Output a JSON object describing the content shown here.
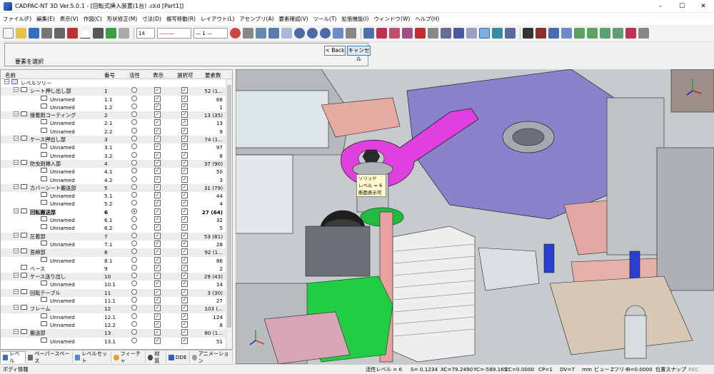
{
  "title": "CADPAC-NT 3D Ver.5.0.1 - [回転式挿入装置(1台) .ckd [Part1]]",
  "window_controls": {
    "minimize": "–",
    "maximize": "☐",
    "close": "✕"
  },
  "menu": [
    "ファイル(F)",
    "編集(E)",
    "表示(V)",
    "作図(C)",
    "形状修正(M)",
    "寸法(D)",
    "複写移動(R)",
    "レイアウト(L)",
    "アセンブリ(A)",
    "要素確認(V)",
    "ツール(T)",
    "拡張機能(I)",
    "ウィンドウ(W)",
    "ヘルプ(H)"
  ],
  "toolbar": {
    "line_width": "14",
    "line_style": "———",
    "line_type": "— 1 —"
  },
  "command_panel": {
    "prompt": "要素を選択",
    "back_label": "< Back",
    "cancel_label": "キャンセル"
  },
  "tree": {
    "headers": {
      "name": "名前",
      "number": "番号",
      "active": "活性",
      "display": "表示",
      "selectable": "選択可",
      "elements": "要素数"
    },
    "root_label": "レベルツリー",
    "rows": [
      {
        "kind": "group",
        "name": "シート押し出し部",
        "number": "1",
        "elements": "52 (1..."
      },
      {
        "kind": "item",
        "name": "Unnamed",
        "number": "1.1",
        "elements": "68"
      },
      {
        "kind": "item",
        "name": "Unnamed",
        "number": "1.2",
        "elements": "1"
      },
      {
        "kind": "group",
        "name": "接着剤コーティング",
        "number": "2",
        "elements": "13 (35)"
      },
      {
        "kind": "item",
        "name": "Unnamed",
        "number": "2.1",
        "elements": "13"
      },
      {
        "kind": "item",
        "name": "Unnamed",
        "number": "2.2",
        "elements": "9"
      },
      {
        "kind": "group",
        "name": "ケース押出し部",
        "number": "3",
        "elements": "74 (1..."
      },
      {
        "kind": "item",
        "name": "Unnamed",
        "number": "3.1",
        "elements": "97"
      },
      {
        "kind": "item",
        "name": "Unnamed",
        "number": "3.2",
        "elements": "8"
      },
      {
        "kind": "group",
        "name": "防虫剤挿入部",
        "number": "4",
        "elements": "37 (90)"
      },
      {
        "kind": "item",
        "name": "Unnamed",
        "number": "4.1",
        "elements": "50"
      },
      {
        "kind": "item",
        "name": "Unnamed",
        "number": "4.2",
        "elements": "3"
      },
      {
        "kind": "group",
        "name": "カバーシート搬送部",
        "number": "5",
        "elements": "31 (79)"
      },
      {
        "kind": "item",
        "name": "Unnamed",
        "number": "5.1",
        "elements": "44"
      },
      {
        "kind": "item",
        "name": "Unnamed",
        "number": "5.2",
        "elements": "4"
      },
      {
        "kind": "group",
        "name": "回転搬送部",
        "number": "6",
        "elements": "27 (64)",
        "selected": true
      },
      {
        "kind": "item",
        "name": "Unnamed",
        "number": "6.1",
        "elements": "32"
      },
      {
        "kind": "item",
        "name": "Unnamed",
        "number": "6.2",
        "elements": "5"
      },
      {
        "kind": "group",
        "name": "圧着部",
        "number": "7",
        "elements": "53 (81)"
      },
      {
        "kind": "item",
        "name": "Unnamed",
        "number": "7.1",
        "elements": "28"
      },
      {
        "kind": "group",
        "name": "吾締部",
        "number": "8",
        "elements": "92 (1..."
      },
      {
        "kind": "item",
        "name": "Unnamed",
        "number": "8.1",
        "elements": "86"
      },
      {
        "kind": "leaf",
        "name": "ベース",
        "number": "9",
        "elements": "2"
      },
      {
        "kind": "group",
        "name": "ケース送り出し",
        "number": "10",
        "elements": "29 (43)"
      },
      {
        "kind": "item",
        "name": "Unnamed",
        "number": "10.1",
        "elements": "14"
      },
      {
        "kind": "group",
        "name": "回転テーブル",
        "number": "11",
        "elements": "3 (30)"
      },
      {
        "kind": "item",
        "name": "Unnamed",
        "number": "11.1",
        "elements": "27"
      },
      {
        "kind": "group",
        "name": "フレーム",
        "number": "12",
        "elements": "103 (..."
      },
      {
        "kind": "item",
        "name": "Unnamed",
        "number": "12.1",
        "elements": "124"
      },
      {
        "kind": "item",
        "name": "Unnamed",
        "number": "12.2",
        "elements": "8"
      },
      {
        "kind": "group",
        "name": "搬送部",
        "number": "13",
        "elements": "80 (1..."
      },
      {
        "kind": "item",
        "name": "Unnamed",
        "number": "13.1",
        "elements": "51"
      }
    ]
  },
  "bottom_tabs": [
    {
      "label": "レベル",
      "icon": "layer-icon",
      "color": "#3a6fb5",
      "active": true
    },
    {
      "label": "ペーパースペース",
      "icon": "paper-icon",
      "color": "#6a6a6a"
    },
    {
      "label": "レベルセット",
      "icon": "layerset-icon",
      "color": "#5588cc"
    },
    {
      "label": "フィーチャ",
      "icon": "feature-icon",
      "color": "#e0a020"
    },
    {
      "label": "材質",
      "icon": "material-icon",
      "color": "#444"
    },
    {
      "label": "DDE",
      "icon": "dde-icon",
      "color": "#3060c0"
    },
    {
      "label": "アニメーション",
      "icon": "animation-icon",
      "color": "#999"
    }
  ],
  "tooltip": {
    "line1": "ソリッド",
    "line2": "レベル = 6",
    "line3": "断面表示可"
  },
  "status": {
    "left": "ボディ情報",
    "active_level": "活性レベル = 6",
    "scale": "S= 0.1234",
    "xc": "XC=79.2490",
    "yc": "YC=-589.165",
    "zc": "ZC=0.0000",
    "cp": "CP=1",
    "dv": "DV=7",
    "unit": "mm",
    "view": "ビュー",
    "zfree": "Zフリー",
    "d": "D=0.0000",
    "snap": "位置スナップ",
    "rec": "REC"
  },
  "colors": {
    "magenta": "#e040e0",
    "green": "#22cc44",
    "gray": "#8a9096",
    "purple": "#8a80cc",
    "salmon": "#e8a8a0"
  }
}
